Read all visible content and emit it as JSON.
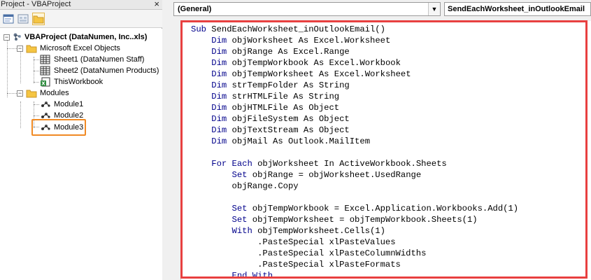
{
  "project_pane": {
    "title": "Project - VBAProject",
    "close_label": "×",
    "tree": {
      "root": "VBAProject (DataNumen, Inc..xls)",
      "excel_objects_folder": "Microsoft Excel Objects",
      "sheet1": "Sheet1 (DataNumen Staff)",
      "sheet2": "Sheet2 (DataNumen Products)",
      "this_workbook": "ThisWorkbook",
      "modules_folder": "Modules",
      "module1": "Module1",
      "module2": "Module2",
      "module3": "Module3",
      "collapse_glyph": "−"
    }
  },
  "code_pane": {
    "object_dropdown": "(General)",
    "procedure_dropdown": "SendEachWorksheet_inOutlookEmail",
    "dropdown_arrow": "▼",
    "lines": [
      {
        "indent": "",
        "kw": "Sub",
        "rest": " SendEachWorksheet_inOutlookEmail()"
      },
      {
        "indent": "    ",
        "kw": "Dim",
        "rest": " objWorksheet As Excel.Worksheet"
      },
      {
        "indent": "    ",
        "kw": "Dim",
        "rest": " objRange As Excel.Range"
      },
      {
        "indent": "    ",
        "kw": "Dim",
        "rest": " objTempWorkbook As Excel.Workbook"
      },
      {
        "indent": "    ",
        "kw": "Dim",
        "rest": " objTempWorksheet As Excel.Worksheet"
      },
      {
        "indent": "    ",
        "kw": "Dim",
        "rest": " strTempFolder As String"
      },
      {
        "indent": "    ",
        "kw": "Dim",
        "rest": " strHTMLFile As String"
      },
      {
        "indent": "    ",
        "kw": "Dim",
        "rest": " objHTMLFile As Object"
      },
      {
        "indent": "    ",
        "kw": "Dim",
        "rest": " objFileSystem As Object"
      },
      {
        "indent": "    ",
        "kw": "Dim",
        "rest": " objTextStream As Object"
      },
      {
        "indent": "    ",
        "kw": "Dim",
        "rest": " objMail As Outlook.MailItem"
      },
      {
        "indent": "",
        "kw": "",
        "rest": ""
      },
      {
        "indent": "    ",
        "kw": "For Each",
        "rest": " objWorksheet In ActiveWorkbook.Sheets"
      },
      {
        "indent": "        ",
        "kw": "Set",
        "rest": " objRange = objWorksheet.UsedRange"
      },
      {
        "indent": "        ",
        "kw": "",
        "rest": "objRange.Copy"
      },
      {
        "indent": "",
        "kw": "",
        "rest": ""
      },
      {
        "indent": "        ",
        "kw": "Set",
        "rest": " objTempWorkbook = Excel.Application.Workbooks.Add(1)"
      },
      {
        "indent": "        ",
        "kw": "Set",
        "rest": " objTempWorksheet = objTempWorkbook.Sheets(1)"
      },
      {
        "indent": "        ",
        "kw": "With",
        "rest": " objTempWorksheet.Cells(1)"
      },
      {
        "indent": "             ",
        "kw": "",
        "rest": ".PasteSpecial xlPasteValues"
      },
      {
        "indent": "             ",
        "kw": "",
        "rest": ".PasteSpecial xlPasteColumnWidths"
      },
      {
        "indent": "             ",
        "kw": "",
        "rest": ".PasteSpecial xlPasteFormats"
      },
      {
        "indent": "        ",
        "kw": "End With",
        "rest": ""
      }
    ]
  },
  "colors": {
    "keyword": "#00008b",
    "highlight_module": "#f08a24",
    "highlight_code": "#e84040"
  }
}
